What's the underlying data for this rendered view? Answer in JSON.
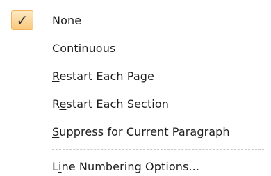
{
  "menu": {
    "checked_glyph": "✓",
    "checked_icon": "checkmark-icon",
    "items": [
      {
        "label": "None",
        "checked": true,
        "access_key": "N"
      },
      {
        "label": "Continuous",
        "checked": false,
        "access_key": "C"
      },
      {
        "label": "Restart Each Page",
        "checked": false,
        "access_key": "R"
      },
      {
        "label": "Restart Each Section",
        "checked": false,
        "access_key": "e"
      },
      {
        "label": "Suppress for Current Paragraph",
        "checked": false,
        "access_key": "S"
      }
    ],
    "footer_item": {
      "label": "Line Numbering Options...",
      "access_key": "i"
    },
    "colors": {
      "check_highlight": "#f9c97c",
      "check_border": "#f2b35b",
      "separator": "#c9c9c9"
    }
  }
}
